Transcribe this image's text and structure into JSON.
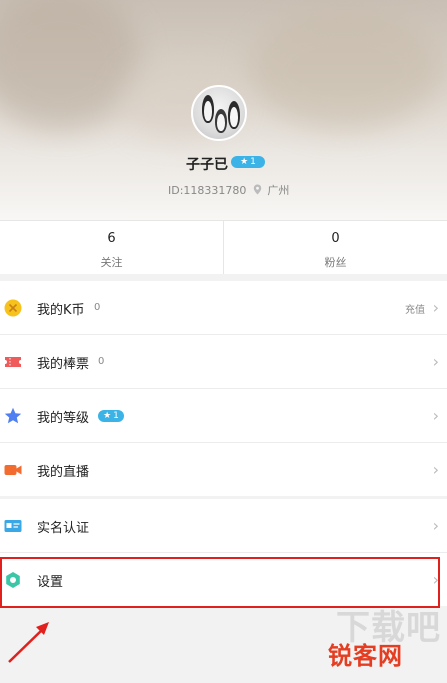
{
  "profile": {
    "username": "子子已",
    "level_badge": "1",
    "id_text": "ID:118331780",
    "location": "广州"
  },
  "stats": [
    {
      "value": "6",
      "label": "关注"
    },
    {
      "value": "0",
      "label": "粉丝"
    }
  ],
  "menu_group1": [
    {
      "label": "我的K币",
      "count": "0",
      "right_text": "充值"
    },
    {
      "label": "我的棒票",
      "count": "0"
    },
    {
      "label": "我的等级",
      "badge": "1"
    },
    {
      "label": "我的直播"
    }
  ],
  "menu_group2": [
    {
      "label": "实名认证"
    },
    {
      "label": "设置"
    }
  ],
  "watermark": {
    "top_text": "下载吧",
    "brand": "锐客网"
  },
  "colors": {
    "badge": "#3bb3e6",
    "highlight": "#e0201c",
    "kcoin": "#f6c21b",
    "ticket": "#ef5a5a",
    "level": "#4f7ff0",
    "live": "#f26b2f",
    "realname": "#3aa8e6",
    "settings": "#3bc7a7"
  }
}
